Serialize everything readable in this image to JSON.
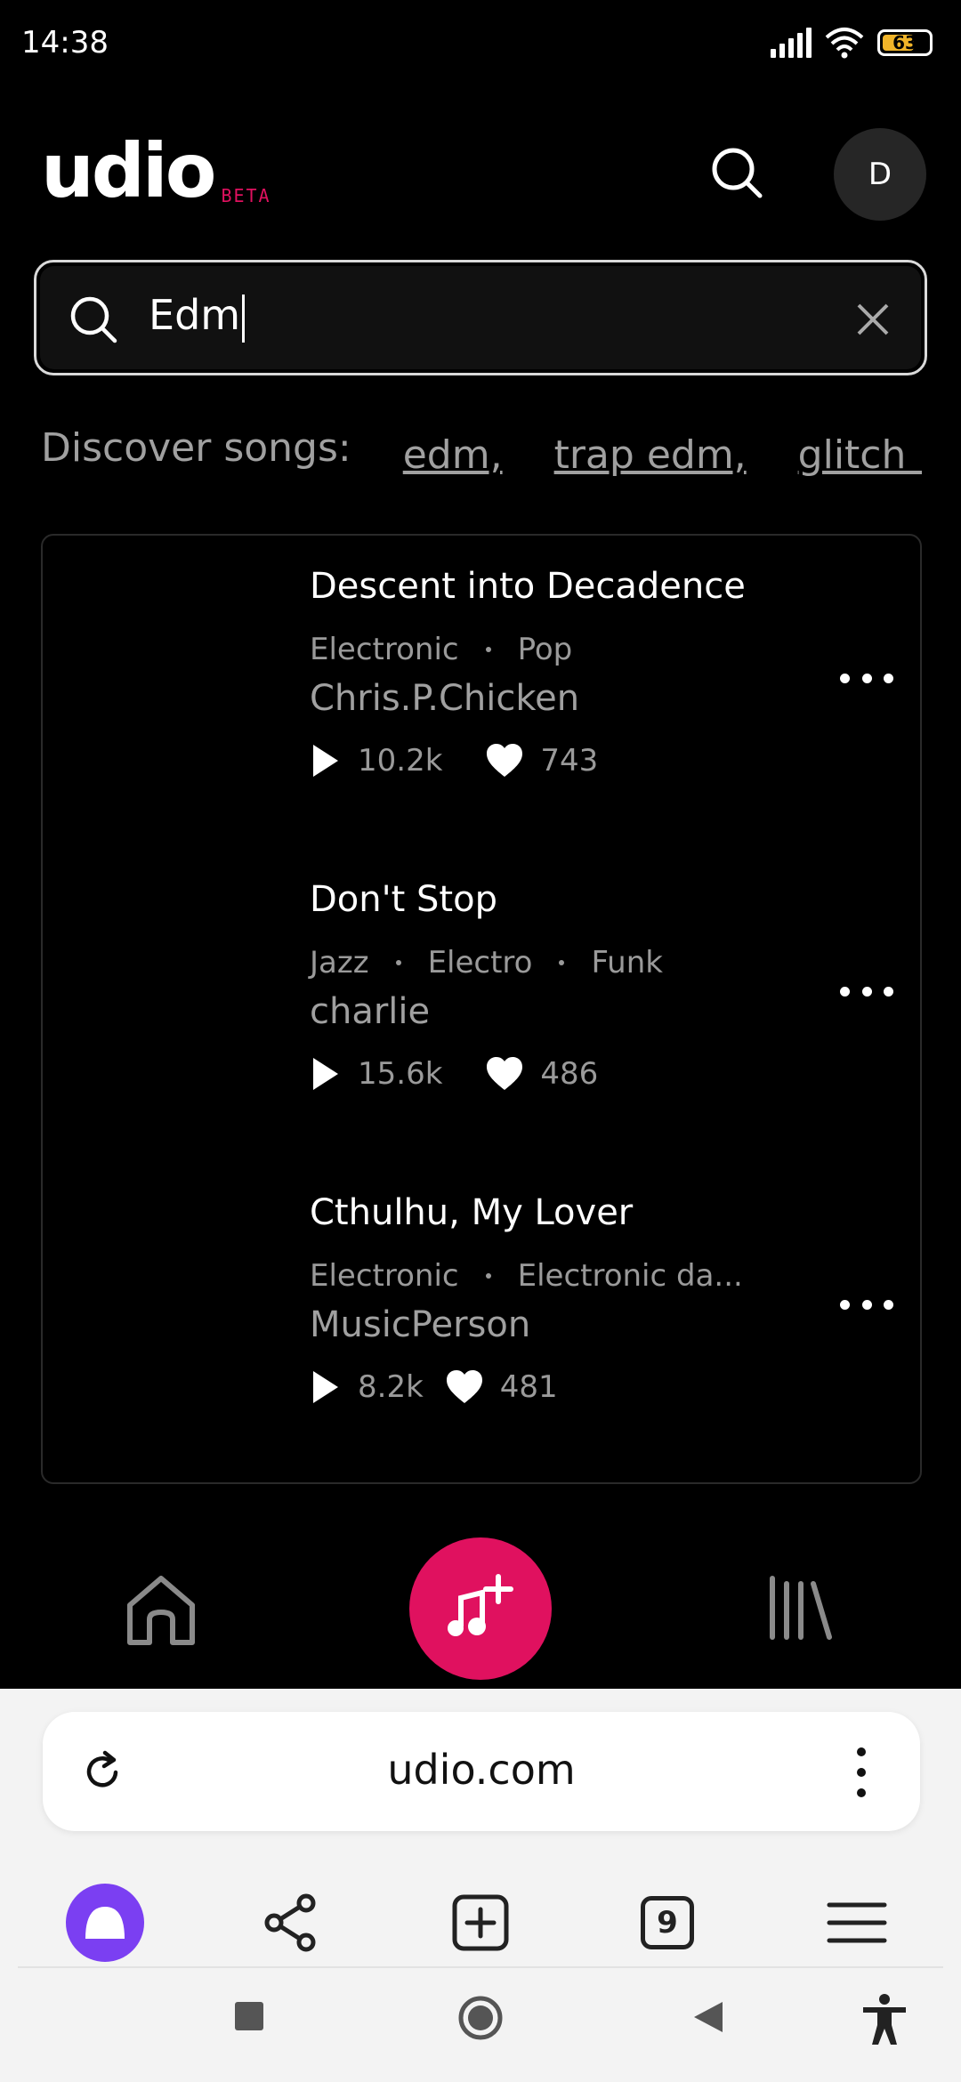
{
  "status_bar": {
    "time": "14:38",
    "battery": "63"
  },
  "header": {
    "logo_text": "udio",
    "logo_badge": "BETA",
    "avatar_initial": "D"
  },
  "search": {
    "value": "Edm"
  },
  "discover": {
    "label": "Discover songs:",
    "chips": [
      "edm,",
      "trap edm,",
      "glitch h"
    ]
  },
  "songs": [
    {
      "title": "Descent into Decadence",
      "tags": [
        "Electronic",
        "Pop"
      ],
      "artist": "Chris.P.Chicken",
      "plays": "10.2k",
      "likes": "743"
    },
    {
      "title": "Don't Stop",
      "tags": [
        "Jazz",
        "Electro",
        "Funk"
      ],
      "artist": "charlie",
      "plays": "15.6k",
      "likes": "486"
    },
    {
      "title": "Cthulhu, My Lover",
      "tags": [
        "Electronic",
        "Electronic da..."
      ],
      "artist": "MusicPerson",
      "plays": "8.2k",
      "likes": "481"
    }
  ],
  "browser": {
    "url": "udio.com",
    "tab_count": "9"
  },
  "colors": {
    "accent": "#e0115f",
    "alice": "#7b3ff2",
    "battery": "#f0b429"
  },
  "icons": [
    "search-icon",
    "close-icon",
    "play-icon",
    "heart-icon",
    "more-icon",
    "home-icon",
    "create-music-icon",
    "library-icon",
    "reload-icon",
    "share-icon",
    "new-tab-icon",
    "menu-icon",
    "back-icon",
    "home-circle-icon",
    "recents-icon",
    "accessibility-icon"
  ]
}
